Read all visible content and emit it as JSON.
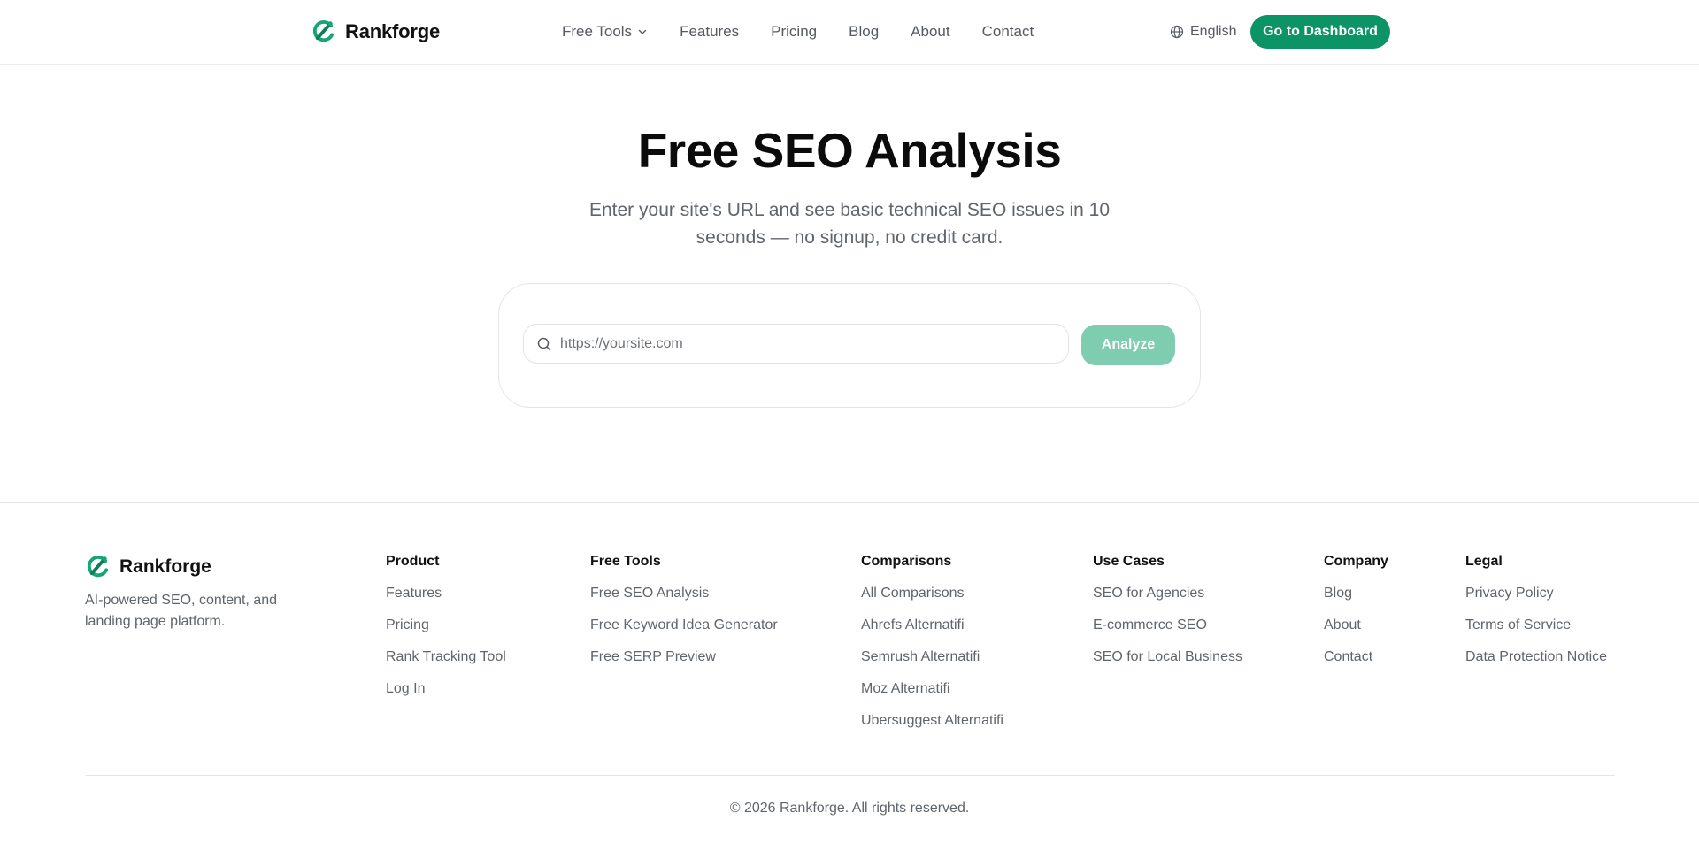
{
  "brand": {
    "name": "Rankforge",
    "color": "#0d9466"
  },
  "nav": {
    "items": [
      {
        "label": "Free Tools"
      },
      {
        "label": "Features"
      },
      {
        "label": "Pricing"
      },
      {
        "label": "Blog"
      },
      {
        "label": "About"
      },
      {
        "label": "Contact"
      }
    ],
    "language": "English",
    "dashboard_label": "Go to Dashboard"
  },
  "hero": {
    "title": "Free SEO Analysis",
    "subtitle": "Enter your site's URL and see basic technical SEO issues in 10 seconds — no signup, no credit card.",
    "url_placeholder": "https://yoursite.com",
    "url_value": "",
    "analyze_label": "Analyze"
  },
  "footer": {
    "brand_name": "Rankforge",
    "tagline": "AI-powered SEO, content, and landing page platform.",
    "columns": [
      {
        "title": "Product",
        "links": [
          "Features",
          "Pricing",
          "Rank Tracking Tool",
          "Log In"
        ]
      },
      {
        "title": "Free Tools",
        "links": [
          "Free SEO Analysis",
          "Free Keyword Idea Generator",
          "Free SERP Preview"
        ]
      },
      {
        "title": "Comparisons",
        "links": [
          "All Comparisons",
          "Ahrefs Alternatifi",
          "Semrush Alternatifi",
          "Moz Alternatifi",
          "Ubersuggest Alternatifi"
        ]
      },
      {
        "title": "Use Cases",
        "links": [
          "SEO for Agencies",
          "E-commerce SEO",
          "SEO for Local Business"
        ]
      },
      {
        "title": "Company",
        "links": [
          "Blog",
          "About",
          "Contact"
        ]
      },
      {
        "title": "Legal",
        "links": [
          "Privacy Policy",
          "Terms of Service",
          "Data Protection Notice"
        ]
      }
    ],
    "copyright": "© 2026 Rankforge. All rights reserved."
  },
  "colors": {
    "primary": "#0d9466",
    "primary_disabled": "#7fcdb0",
    "text_muted": "#5f656b",
    "border": "#e6e6e6"
  }
}
